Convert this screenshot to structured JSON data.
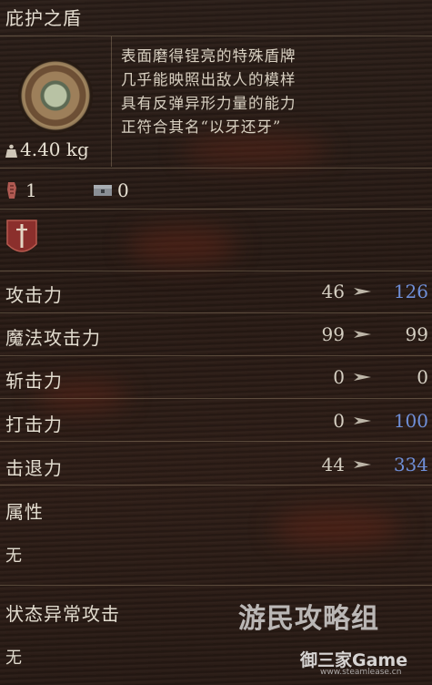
{
  "item": {
    "name": "庇护之盾",
    "description": [
      "表面磨得锃亮的特殊盾牌",
      "几乎能映照出敌人的模样",
      "具有反弹异形力量的能力",
      "正符合其名“以牙还牙”"
    ],
    "weight": "4.40 kg",
    "icon": "round-shield-icon"
  },
  "counts": {
    "first": "1",
    "second": "0"
  },
  "stats": [
    {
      "label": "攻击力",
      "current": "46",
      "new": "126",
      "new_color": "#6f8fd8"
    },
    {
      "label": "魔法攻击力",
      "current": "99",
      "new": "99",
      "new_color": "#d5cfc2"
    },
    {
      "label": "斩击力",
      "current": "0",
      "new": "0",
      "new_color": "#d5cfc2"
    },
    {
      "label": "打击力",
      "current": "0",
      "new": "100",
      "new_color": "#6f8fd8"
    },
    {
      "label": "击退力",
      "current": "44",
      "new": "334",
      "new_color": "#6f8fd8"
    }
  ],
  "attribute": {
    "label": "属性",
    "value": "无"
  },
  "status": {
    "label": "状态异常攻击",
    "value": "无"
  },
  "watermark": {
    "line1": "游民攻略组",
    "line2": "御三家Game",
    "line3": "www.steamlease.cn"
  }
}
